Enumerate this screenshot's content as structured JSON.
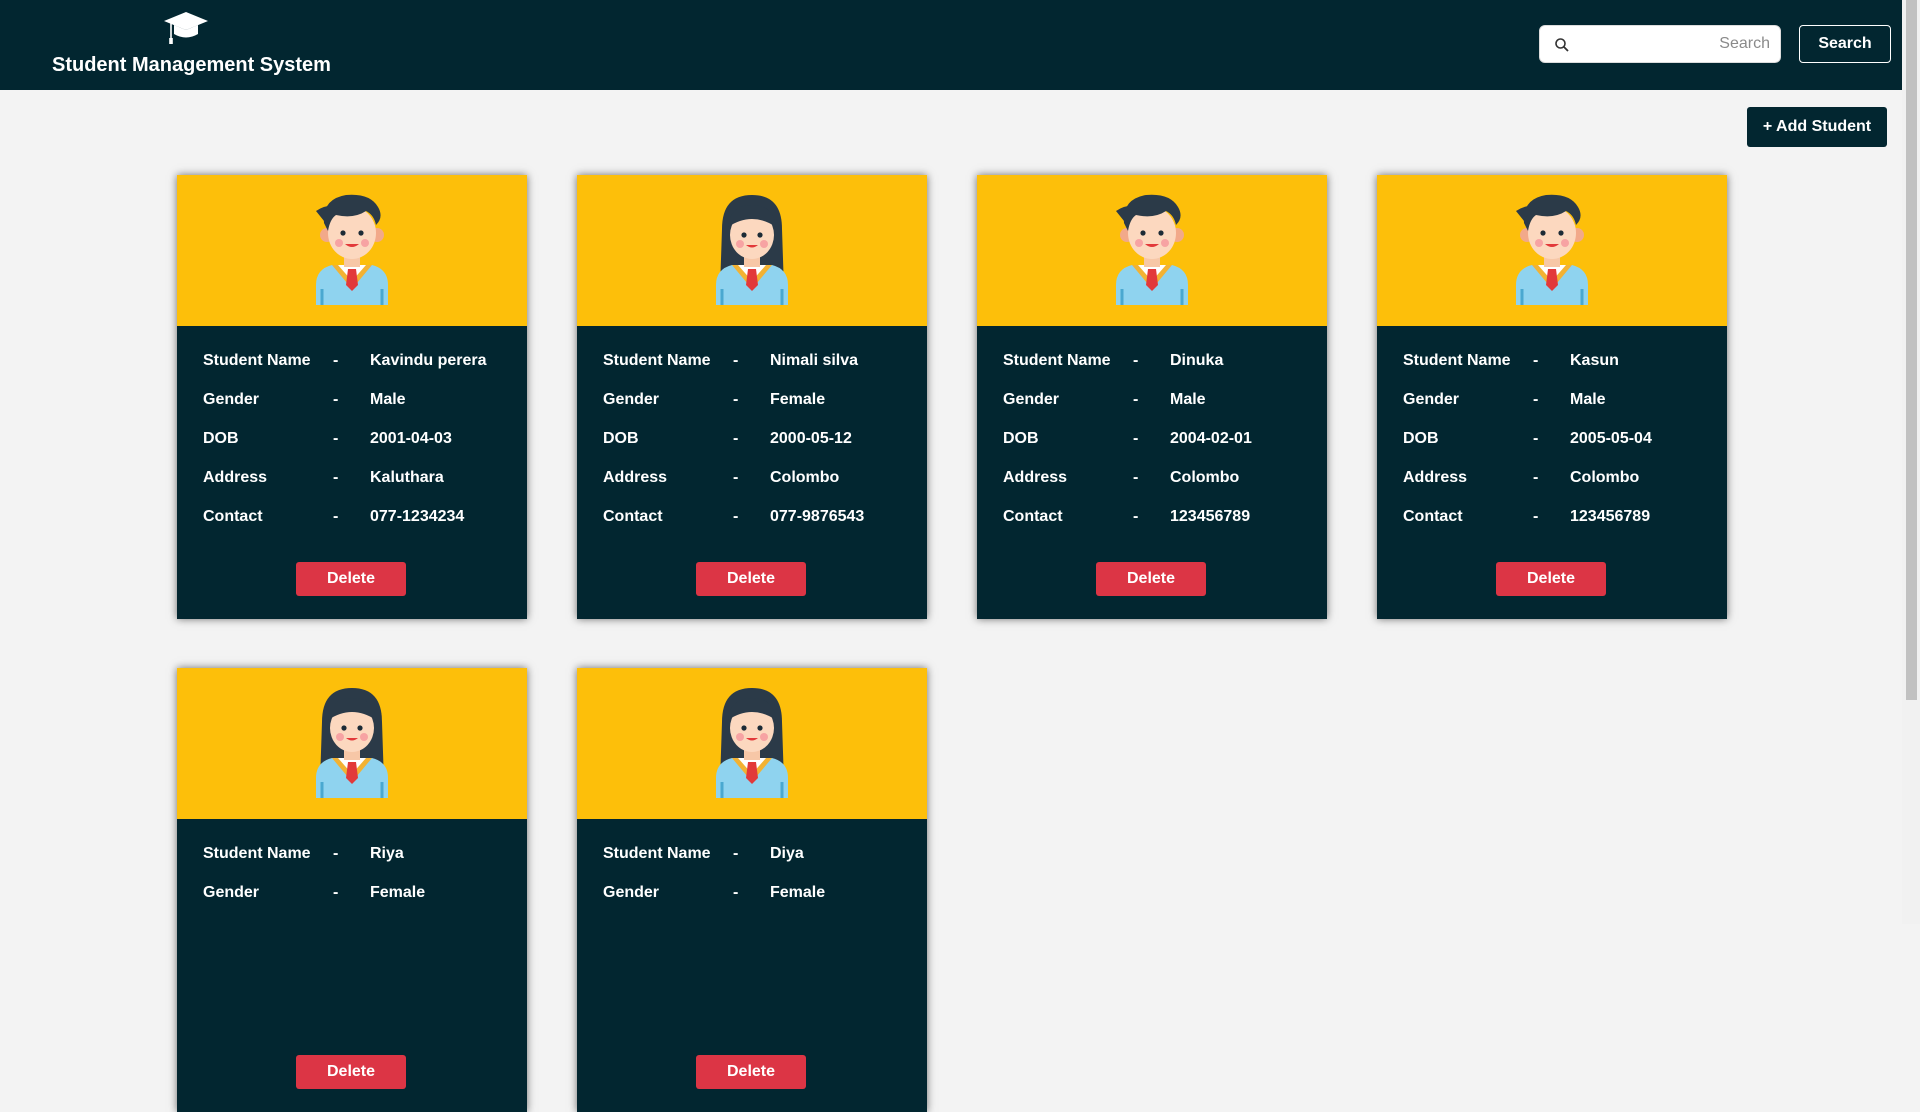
{
  "app": {
    "title": "Student Management System",
    "logo_icon": "graduation-cap-icon"
  },
  "search": {
    "placeholder": "Search",
    "value": "",
    "button_label": "Search",
    "icon": "search-icon"
  },
  "actions": {
    "add_label": "+ Add Student"
  },
  "colors": {
    "navbar": "#022630",
    "card_top": "#fdbf0a",
    "card_body": "#022630",
    "delete": "#dc3545",
    "page_bg": "#f3f3f3"
  },
  "field_labels": {
    "name": "Student Name",
    "gender": "Gender",
    "dob": "DOB",
    "address": "Address",
    "contact": "Contact",
    "separator": "-"
  },
  "delete_label": "Delete",
  "students": [
    {
      "name": "Kavindu perera",
      "gender": "Male",
      "dob": "2001-04-03",
      "address": "Kaluthara",
      "contact": "077-1234234",
      "avatar": "male-student-icon"
    },
    {
      "name": "Nimali silva",
      "gender": "Female",
      "dob": "2000-05-12",
      "address": "Colombo",
      "contact": "077-9876543",
      "avatar": "female-student-icon"
    },
    {
      "name": "Dinuka",
      "gender": "Male",
      "dob": "2004-02-01",
      "address": "Colombo",
      "contact": "123456789",
      "avatar": "male-student-icon"
    },
    {
      "name": "Kasun",
      "gender": "Male",
      "dob": "2005-05-04",
      "address": "Colombo",
      "contact": "123456789",
      "avatar": "male-student-icon"
    },
    {
      "name": "Riya",
      "gender": "Female",
      "avatar": "female-student-icon"
    },
    {
      "name": "Diya",
      "gender": "Female",
      "avatar": "female-student-icon"
    }
  ]
}
